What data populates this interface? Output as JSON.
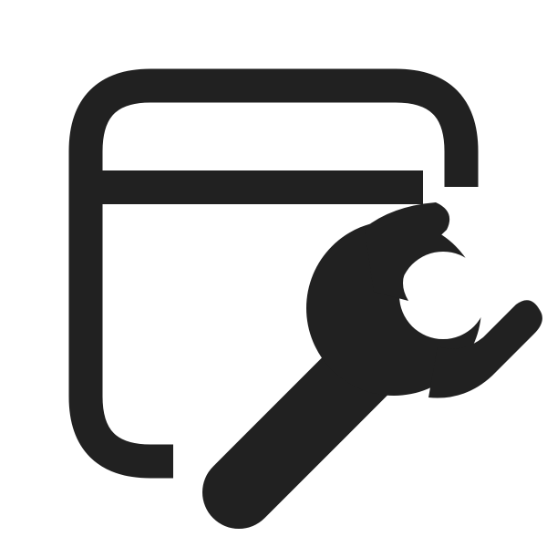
{
  "icon": {
    "name": "app-window-wrench-icon",
    "parts": [
      "window-frame-icon",
      "wrench-icon"
    ],
    "color": "#212121",
    "background": "#ffffff"
  }
}
